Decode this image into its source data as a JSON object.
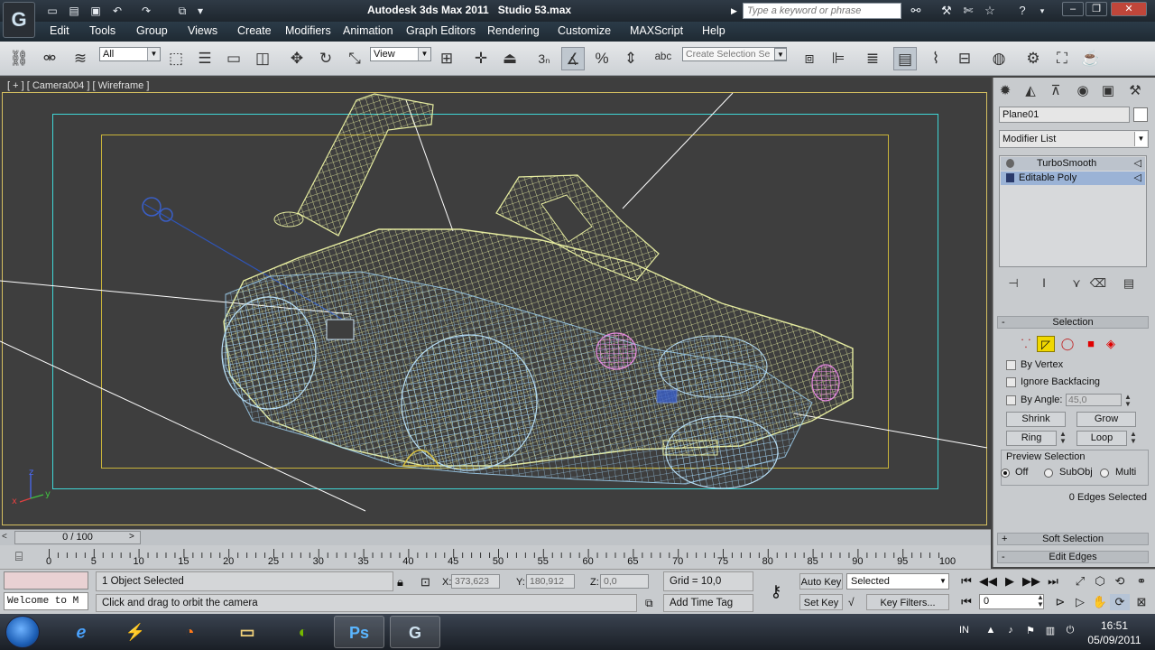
{
  "window": {
    "title": "Autodesk 3ds Max 2011",
    "file": "Studio 53.max",
    "search_placeholder": "Type a keyword or phrase"
  },
  "menubar": {
    "items": [
      "Edit",
      "Tools",
      "Group",
      "Views",
      "Create",
      "Modifiers",
      "Animation",
      "Graph Editors",
      "Rendering",
      "Customize",
      "MAXScript",
      "Help"
    ]
  },
  "toolbar": {
    "selection_filter": "All",
    "ref_coord_system": "View",
    "named_selection_placeholder": "Create Selection Se",
    "snap_label": "3"
  },
  "viewport": {
    "label": "[ + ] [ Camera004 ] [ Wireframe ]",
    "axis_labels": {
      "x": "x",
      "y": "y",
      "z": "z"
    }
  },
  "command_panel": {
    "object_name": "Plane01",
    "modifier_list": "Modifier List",
    "stack": [
      "TurboSmooth",
      "Editable Poly"
    ],
    "selection_rollout": {
      "title": "Selection",
      "by_vertex": "By Vertex",
      "ignore_backfacing": "Ignore Backfacing",
      "by_angle": "By Angle:",
      "angle_value": "45,0",
      "shrink": "Shrink",
      "grow": "Grow",
      "ring": "Ring",
      "loop": "Loop",
      "preview_title": "Preview Selection",
      "preview_options": [
        "Off",
        "SubObj",
        "Multi"
      ],
      "edges_selected": "0 Edges Selected"
    },
    "soft_selection": "Soft Selection",
    "edit_edges": "Edit Edges"
  },
  "timeline": {
    "current": "0 / 100",
    "ticks": [
      "0",
      "5",
      "10",
      "15",
      "20",
      "25",
      "30",
      "35",
      "40",
      "45",
      "50",
      "55",
      "60",
      "65",
      "70",
      "75",
      "80",
      "85",
      "90",
      "95",
      "100"
    ]
  },
  "status": {
    "maxscript_line": "Welcome to M",
    "selection": "1 Object Selected",
    "prompt": "Click and drag to orbit the camera",
    "x_label": "X:",
    "x": "373,623",
    "y_label": "Y:",
    "y": "180,912",
    "z_label": "Z:",
    "z": "0,0",
    "grid": "Grid = 10,0",
    "add_time_tag": "Add Time Tag",
    "auto_key": "Auto Key",
    "set_key": "Set Key",
    "key_mode": "Selected",
    "key_filters": "Key Filters...",
    "frame": "0"
  },
  "taskbar": {
    "apps": [
      "internet-explorer",
      "winamp",
      "firefox",
      "file-explorer",
      "nvidia",
      "photoshop",
      "3dsmax"
    ],
    "photoshop_label": "Ps",
    "tray_language": "IN",
    "time": "16:51",
    "date": "05/09/2011"
  },
  "colors": {
    "viewport_bg": "#3e3e3e",
    "wire_main": "#e6eca0",
    "wire_blue": "#9fd0f0",
    "wire_pink": "#e78be0",
    "safe_frame_cyan": "#3fd6d6",
    "safe_frame_yellow": "#c9b43a"
  }
}
